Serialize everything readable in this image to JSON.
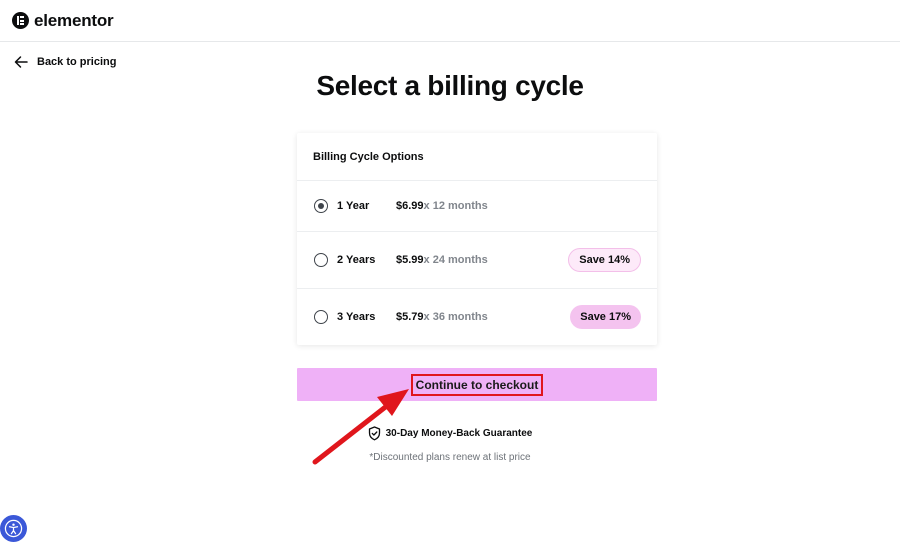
{
  "brand": {
    "name": "elementor"
  },
  "nav": {
    "back_label": "Back to pricing"
  },
  "page": {
    "title": "Select a billing cycle"
  },
  "billing": {
    "header": "Billing Cycle Options",
    "selected_index": 0,
    "options": [
      {
        "label": "1 Year",
        "price": "$6.99",
        "months": "x 12 months",
        "badge": ""
      },
      {
        "label": "2 Years",
        "price": "$5.99",
        "months": "x 24 months",
        "badge": "Save 14%"
      },
      {
        "label": "3 Years",
        "price": "$5.79",
        "months": "x 36 months",
        "badge": "Save 17%"
      }
    ]
  },
  "cta": {
    "label": "Continue to checkout"
  },
  "guarantee": {
    "label": "30-Day Money-Back Guarantee"
  },
  "note": {
    "text": "*Discounted plans renew at list price"
  },
  "icons": {
    "logo": "elementor-logo-icon",
    "back": "arrow-left-icon",
    "guarantee": "shield-check-icon",
    "accessibility": "accessibility-icon",
    "annotation": "red-arrow-annotation"
  },
  "colors": {
    "cta_bg": "#efb1f7",
    "badge_light_bg": "#fdeaf9",
    "badge_strong_bg": "#f4c3ef",
    "annotation": "#e0161c",
    "accessibility_bg": "#3b58d8"
  }
}
